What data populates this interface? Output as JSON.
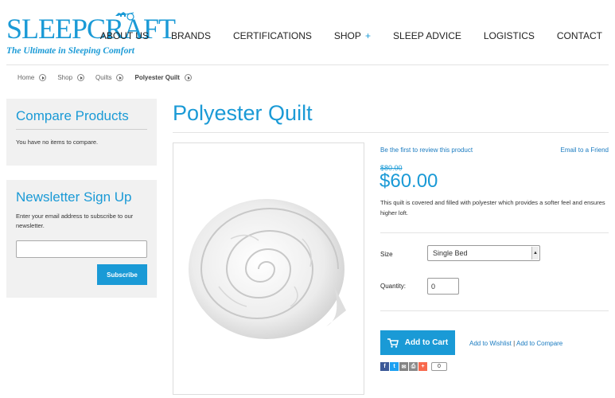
{
  "header": {
    "logo_text": "SLEEPCRAFT",
    "logo_tagline": "The Ultimate in Sleeping Comfort",
    "nav": [
      {
        "label": "ABOUT US"
      },
      {
        "label": "BRANDS"
      },
      {
        "label": "CERTIFICATIONS"
      },
      {
        "label": "SHOP",
        "suffix": "+"
      },
      {
        "label": "SLEEP ADVICE"
      },
      {
        "label": "LOGISTICS"
      },
      {
        "label": "CONTACT"
      }
    ]
  },
  "breadcrumb": [
    "Home",
    "Shop",
    "Quilts",
    "Polyester Quilt"
  ],
  "sidebar": {
    "compare": {
      "title": "Compare Products",
      "text": "You have no items to compare."
    },
    "newsletter": {
      "title": "Newsletter Sign Up",
      "text": "Enter your email address to subscribe to our newsletter.",
      "email_value": "",
      "button": "Subscribe"
    }
  },
  "product": {
    "title": "Polyester Quilt",
    "review_link": "Be the first to review this product",
    "email_link": "Email to a Friend",
    "old_price": "$80.00",
    "price": "$60.00",
    "description": "This quilt is covered and filled with polyester which provides a softer feel and ensures higher loft.",
    "size_label": "Size",
    "size_value": "Single Bed",
    "quantity_label": "Quantity:",
    "quantity_value": "0",
    "add_to_cart": "Add to Cart",
    "wishlist_link": "Add to Wishlist",
    "separator": "|",
    "compare_link": "Add to Compare",
    "share_count": "0"
  },
  "colors": {
    "accent": "#1a9ad6",
    "facebook": "#3b5998",
    "twitter": "#1da1f2",
    "email": "#848484",
    "print": "#8a8a8a",
    "addthis": "#f8694d"
  },
  "icons": [
    "horse-carriage-icon",
    "breadcrumb-arrow-icon",
    "cart-icon",
    "facebook-icon",
    "twitter-icon",
    "email-icon",
    "print-icon",
    "addthis-plus-icon",
    "select-arrow-icon"
  ]
}
